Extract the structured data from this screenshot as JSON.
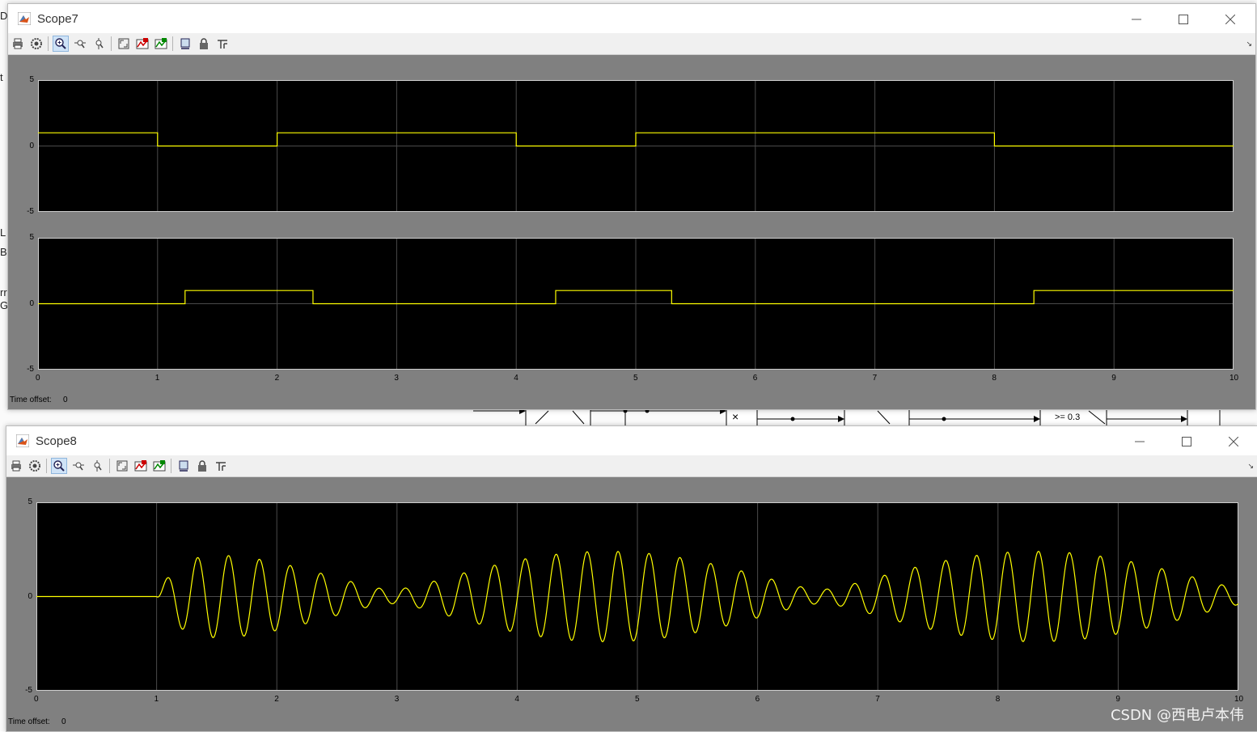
{
  "background": {
    "left_letters": [
      "Di",
      "t",
      "L",
      "B",
      "rr",
      "G"
    ],
    "block_label": ">= 0.3",
    "multiply_symbol": "×"
  },
  "scope7": {
    "title": "Scope7",
    "time_offset_label": "Time offset:",
    "time_offset_value": "0",
    "toolbar": [
      "print-icon",
      "settings-icon",
      "zoom-in-icon",
      "zoom-x-icon",
      "zoom-y-icon",
      "autoscale-icon",
      "save-axes-icon",
      "restore-axes-icon",
      "float-icon",
      "lock-icon",
      "signal-selector-icon"
    ]
  },
  "scope8": {
    "title": "Scope8",
    "time_offset_label": "Time offset:",
    "time_offset_value": "0",
    "toolbar": [
      "print-icon",
      "settings-icon",
      "zoom-in-icon",
      "zoom-x-icon",
      "zoom-y-icon",
      "autoscale-icon",
      "save-axes-icon",
      "restore-axes-icon",
      "float-icon",
      "lock-icon",
      "signal-selector-icon"
    ]
  },
  "watermark": "CSDN @西电卢本伟",
  "colors": {
    "trace": "#ffff00",
    "axes_bg": "#000000",
    "figure_bg": "#808080",
    "grid": "#4a4a4a"
  },
  "chart_data": [
    {
      "type": "line",
      "window": "Scope7",
      "ylim": [
        -5,
        5
      ],
      "xlim": [
        0,
        10
      ],
      "yticks": [
        "5",
        "0",
        "-5"
      ],
      "xticks": [],
      "grid": true,
      "x": [
        0,
        1,
        1,
        2,
        2,
        4,
        4,
        5,
        5,
        8,
        8,
        10
      ],
      "y": [
        1,
        1,
        0,
        0,
        1,
        1,
        0,
        0,
        1,
        1,
        0,
        0
      ]
    },
    {
      "type": "line",
      "window": "Scope7",
      "ylim": [
        -5,
        5
      ],
      "xlim": [
        0,
        10
      ],
      "yticks": [
        "5",
        "0",
        "-5"
      ],
      "xticks": [
        "0",
        "1",
        "2",
        "3",
        "4",
        "5",
        "6",
        "7",
        "8",
        "9",
        "10"
      ],
      "grid": true,
      "x": [
        0,
        1.23,
        1.23,
        2.3,
        2.3,
        4.33,
        4.33,
        5.3,
        5.3,
        8.33,
        8.33,
        10
      ],
      "y": [
        0,
        0,
        1,
        1,
        0,
        0,
        1,
        1,
        0,
        0,
        1,
        1
      ]
    },
    {
      "type": "line",
      "window": "Scope8",
      "ylim": [
        -5,
        5
      ],
      "xlim": [
        0,
        10
      ],
      "yticks": [
        "5",
        "0",
        "-5"
      ],
      "xticks": [
        "0",
        "1",
        "2",
        "3",
        "4",
        "5",
        "6",
        "7",
        "8",
        "9",
        "10"
      ],
      "grid": true,
      "signal": "sum of two sinusoids, zero before t=1",
      "start_time": 1,
      "amplitude_peak": 2.4,
      "frequency_hz": 4.0
    }
  ]
}
